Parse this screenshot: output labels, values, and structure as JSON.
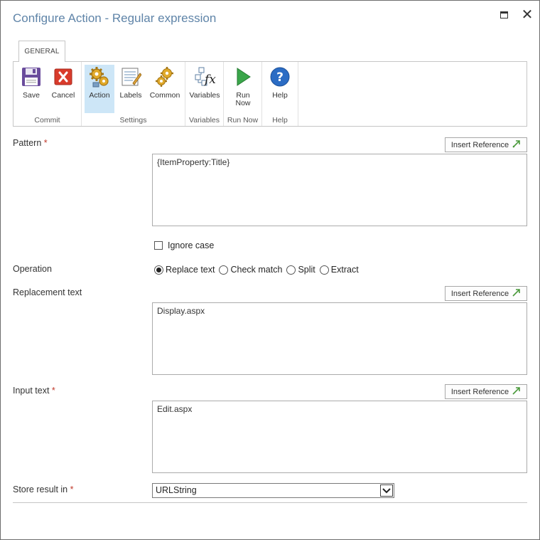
{
  "window": {
    "title": "Configure Action - Regular expression",
    "maximize_icon": "maximize-icon",
    "close_label": "✕"
  },
  "ribbon": {
    "tab": "GENERAL",
    "groups": {
      "commit": {
        "label": "Commit",
        "save": "Save",
        "cancel": "Cancel"
      },
      "settings": {
        "label": "Settings",
        "action": "Action",
        "labels": "Labels",
        "common": "Common"
      },
      "variables": {
        "label": "Variables",
        "variables": "Variables"
      },
      "runnow": {
        "label": "Run Now",
        "run_line1": "Run",
        "run_line2": "Now"
      },
      "help": {
        "label": "Help",
        "help": "Help"
      }
    }
  },
  "form": {
    "insert_reference": "Insert Reference",
    "required_mark": "*",
    "pattern": {
      "label": "Pattern",
      "value": "{ItemProperty:Title}"
    },
    "ignore_case": {
      "label": "Ignore case",
      "checked": false
    },
    "operation": {
      "label": "Operation",
      "options": [
        "Replace text",
        "Check match",
        "Split",
        "Extract"
      ],
      "selected": "Replace text"
    },
    "replacement": {
      "label": "Replacement text",
      "value": "Display.aspx"
    },
    "input": {
      "label": "Input text",
      "value": "Edit.aspx"
    },
    "store": {
      "label": "Store result in",
      "value": "URLString"
    }
  },
  "colors": {
    "title": "#5f84a8",
    "active_button": "#cde6f7",
    "required": "#c0392b"
  }
}
